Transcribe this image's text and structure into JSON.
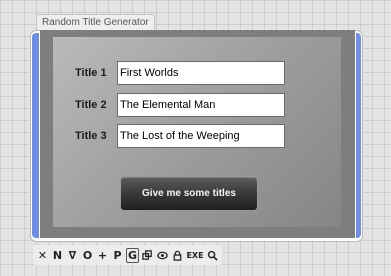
{
  "window": {
    "tab_title": "Random Title Generator"
  },
  "form": {
    "rows": [
      {
        "label": "Title 1",
        "value": "First Worlds"
      },
      {
        "label": "Title 2",
        "value": "The Elemental Man"
      },
      {
        "label": "Title 3",
        "value": "The Lost of the Weeping"
      }
    ],
    "button_label": "Give me some titles"
  },
  "toolbar": {
    "tools": [
      {
        "name": "delete-icon",
        "glyph": "✕"
      },
      {
        "name": "n-icon",
        "glyph": "N"
      },
      {
        "name": "triangle-down-icon",
        "glyph": "∇"
      },
      {
        "name": "circle-icon",
        "glyph": "O"
      },
      {
        "name": "plus-icon",
        "glyph": "+"
      },
      {
        "name": "p-icon",
        "glyph": "P"
      },
      {
        "name": "g-icon",
        "glyph": "G",
        "active": true
      },
      {
        "name": "copy-icon",
        "glyph": ""
      },
      {
        "name": "eye-icon",
        "glyph": ""
      },
      {
        "name": "lock-icon",
        "glyph": ""
      },
      {
        "name": "exe-icon",
        "glyph": "EXE"
      },
      {
        "name": "search-icon",
        "glyph": ""
      }
    ]
  },
  "colors": {
    "accent": "#6f8ee6",
    "button_dark": "#2a2a2a",
    "panel": "#7e7e7e"
  }
}
